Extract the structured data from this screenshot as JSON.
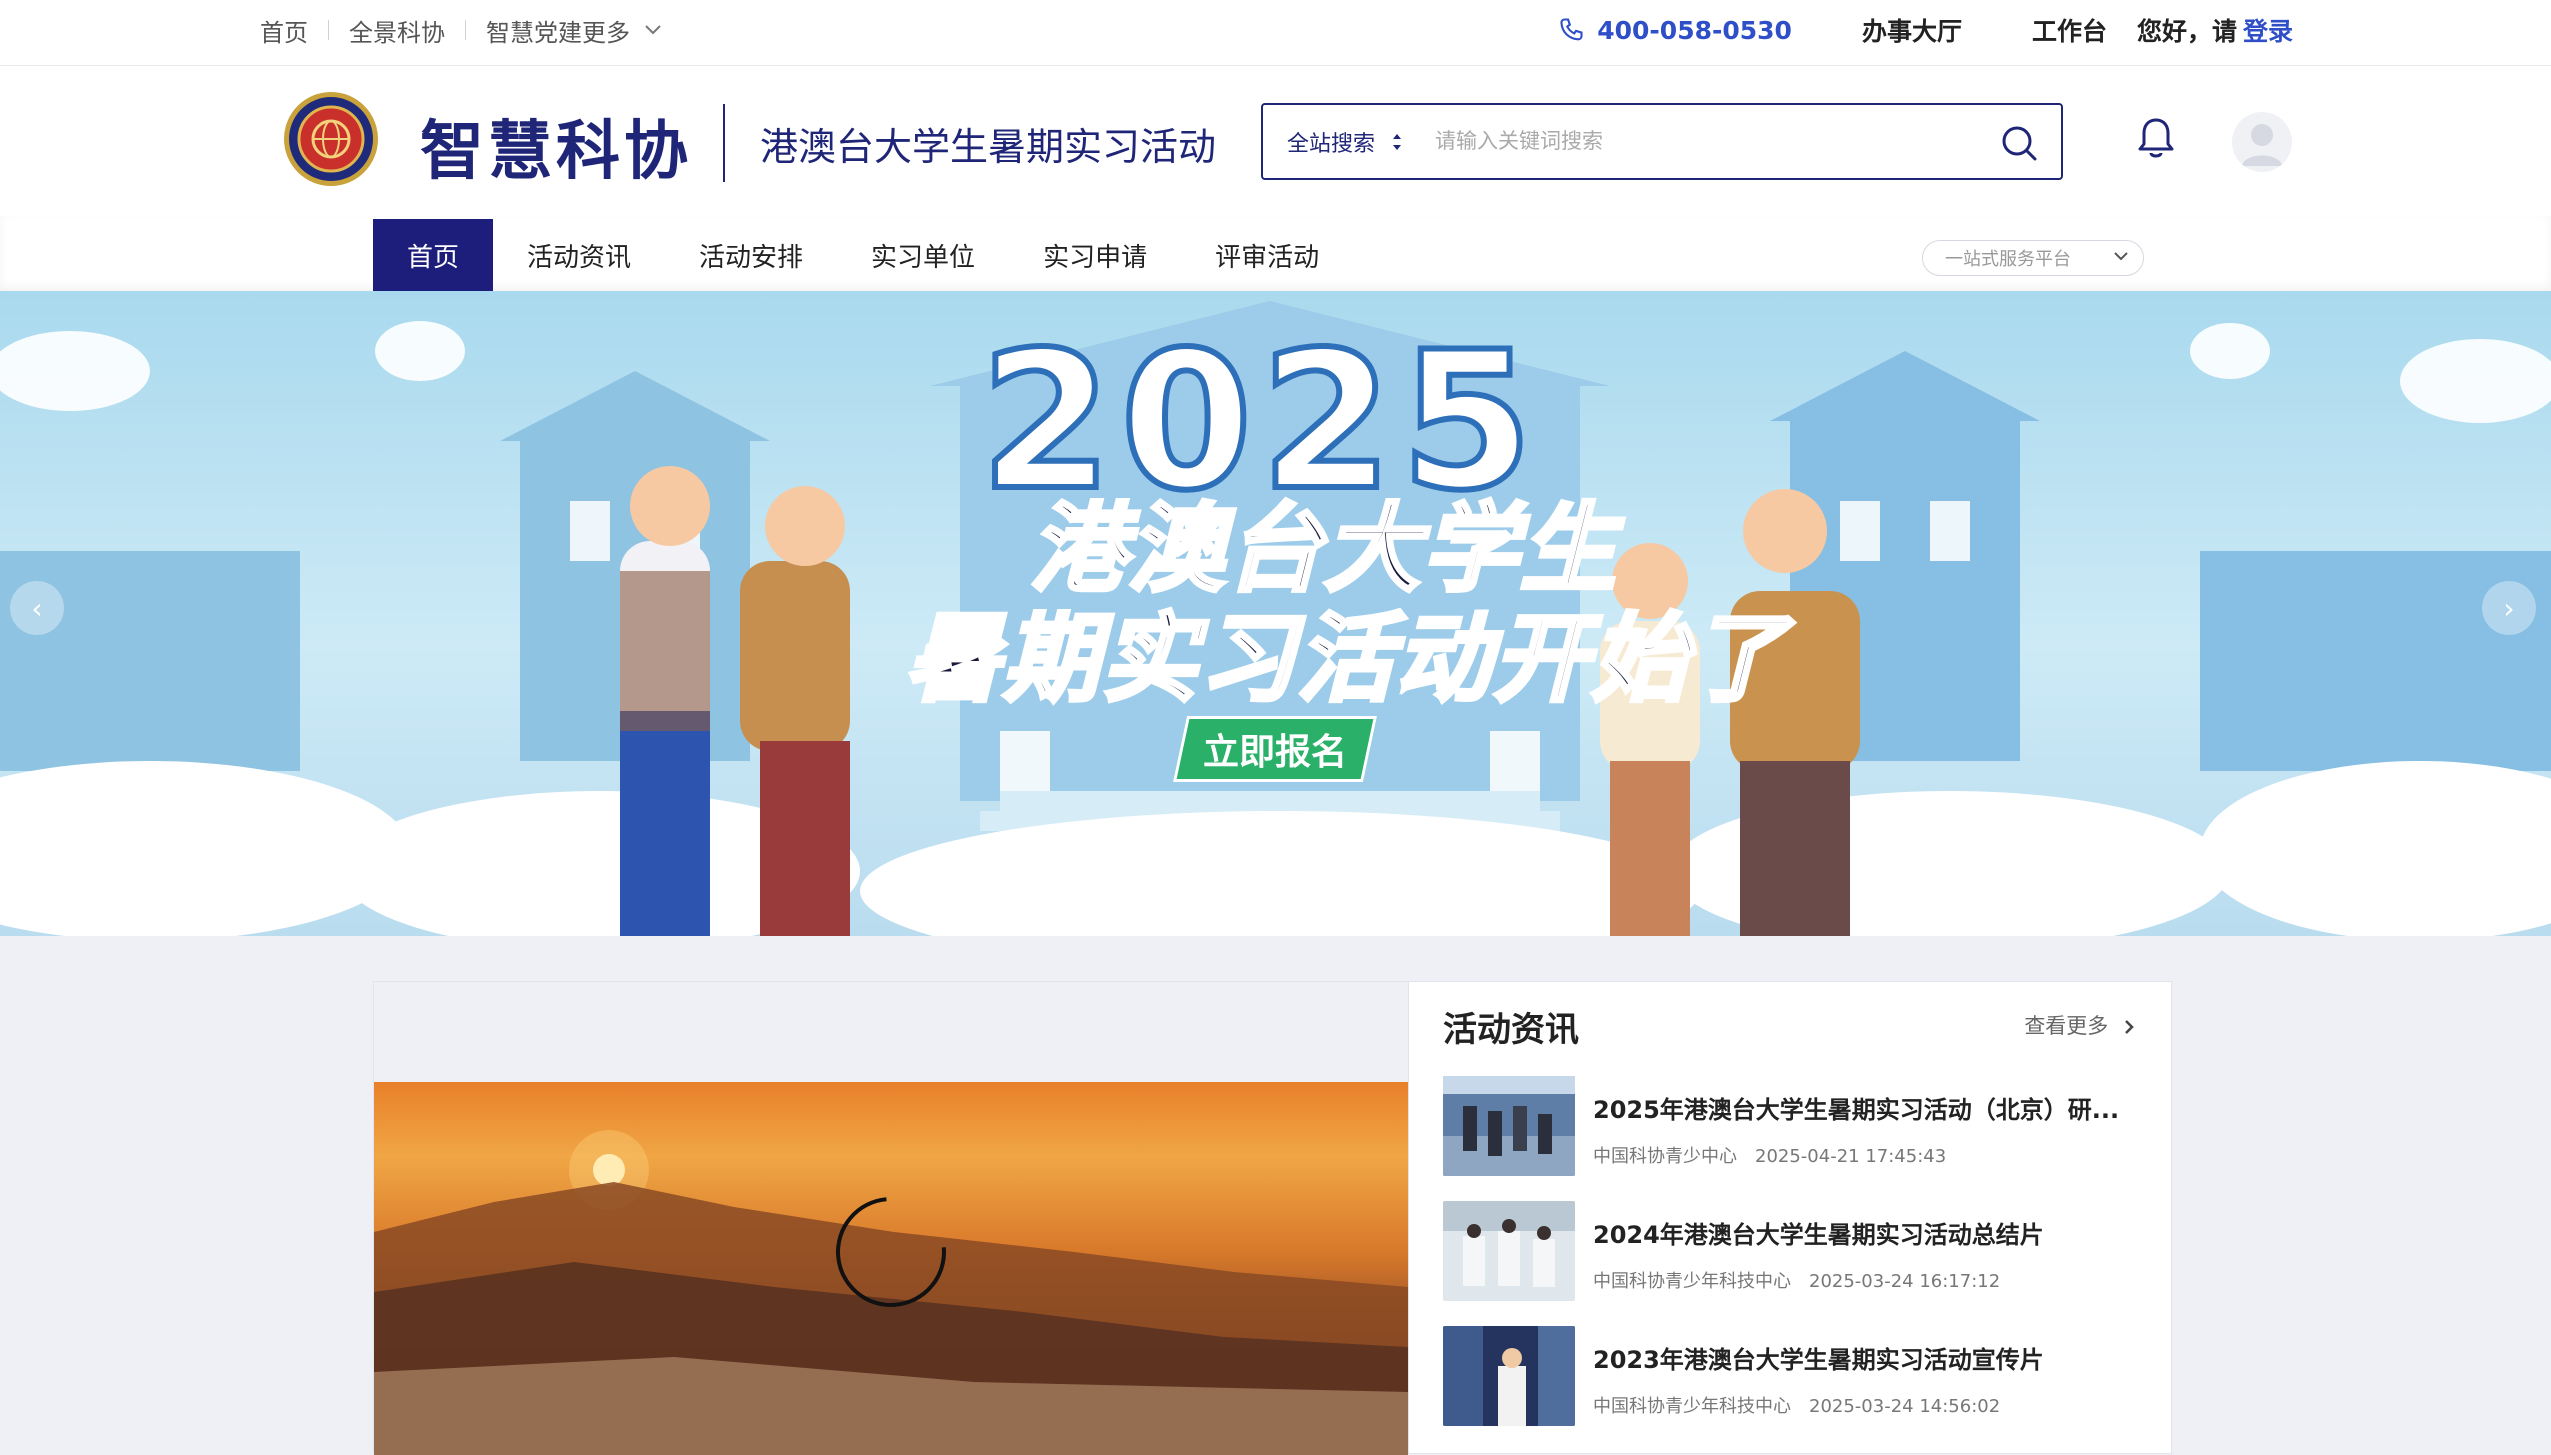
{
  "topbar": {
    "links": [
      "首页",
      "全景科协",
      "智慧党建更多"
    ],
    "phone": "400-058-0530",
    "service_hall": "办事大厅",
    "workbench": "工作台",
    "greeting": "您好，请",
    "login": "登录"
  },
  "header": {
    "logo_text": "智慧科协",
    "subtitle": "港澳台大学生暑期实习活动",
    "search_scope": "全站搜索",
    "search_placeholder": "请输入关键词搜索"
  },
  "nav": {
    "items": [
      "首页",
      "活动资讯",
      "活动安排",
      "实习单位",
      "实习申请",
      "评审活动"
    ],
    "active_index": 0,
    "platform_select": "一站式服务平台"
  },
  "banner": {
    "year": "2025",
    "line1": "港澳台大学生",
    "line2": "暑期实习活动开始了",
    "cta": "立即报名",
    "prev_icon": "‹",
    "next_icon": "›"
  },
  "news": {
    "title": "活动资讯",
    "more": "查看更多",
    "items": [
      {
        "title": "2025年港澳台大学生暑期实习活动（北京）研...",
        "source": "中国科协青少中心",
        "date": "2025-04-21 17:45:43"
      },
      {
        "title": "2024年港澳台大学生暑期实习活动总结片",
        "source": "中国科协青少年科技中心",
        "date": "2025-03-24 16:17:12"
      },
      {
        "title": "2023年港澳台大学生暑期实习活动宣传片",
        "source": "中国科协青少年科技中心",
        "date": "2025-03-24 14:56:02"
      }
    ]
  },
  "colors": {
    "brand_navy": "#1f2577",
    "nav_active": "#1d1d7c",
    "link_blue": "#2f4fc9",
    "cta_green": "#2bb06a"
  }
}
